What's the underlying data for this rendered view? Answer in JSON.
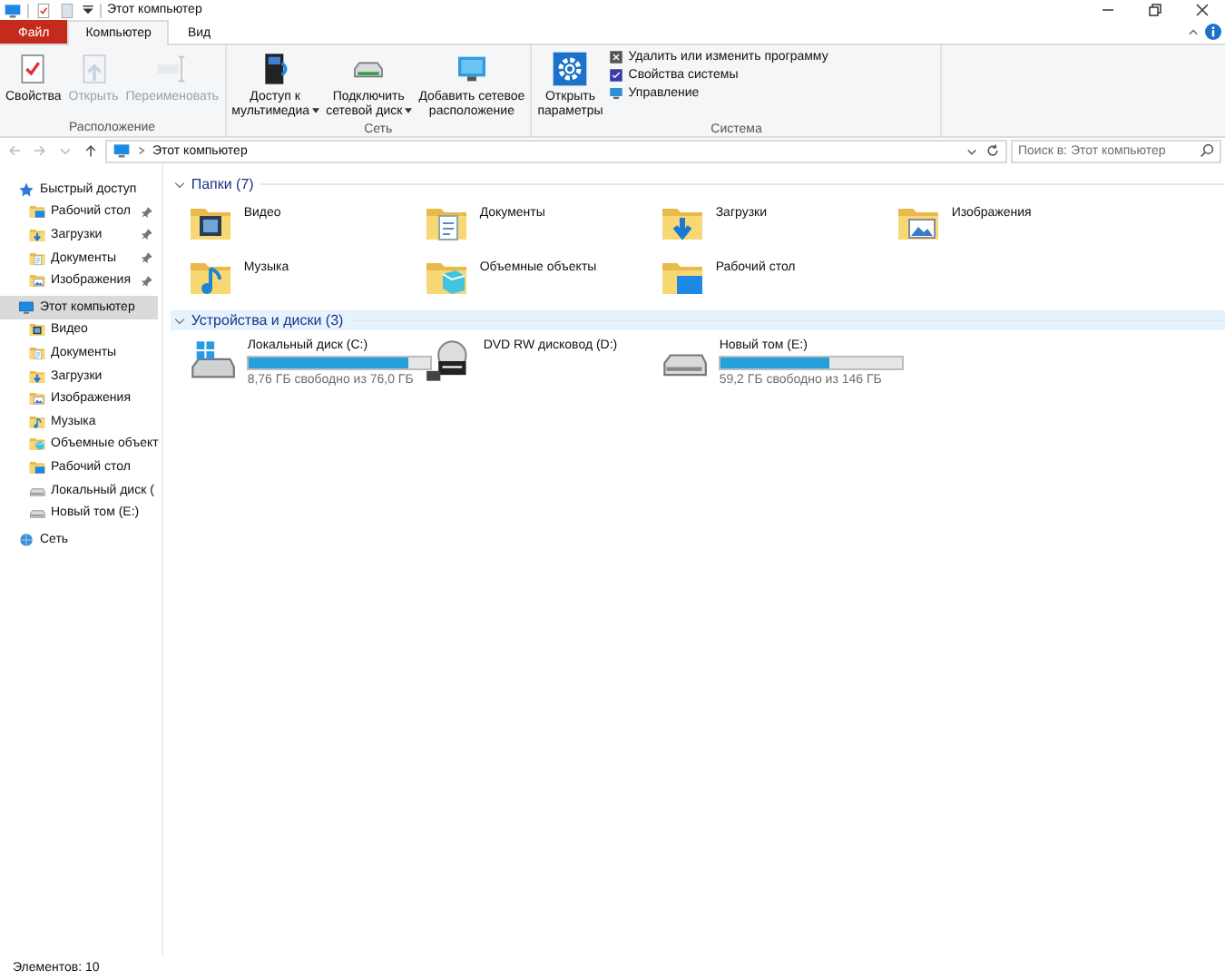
{
  "window": {
    "title": "Этот компьютер"
  },
  "ribbon": {
    "tabs": [
      {
        "label": "Файл",
        "kind": "file",
        "selected": false
      },
      {
        "label": "Компьютер",
        "kind": "tab",
        "selected": true
      },
      {
        "label": "Вид",
        "kind": "tab",
        "selected": false
      }
    ],
    "groups": [
      {
        "label": "Расположение",
        "buttons": [
          {
            "label": "Свойства",
            "disabled": false,
            "dropdown": false
          },
          {
            "label": "Открыть",
            "disabled": true,
            "dropdown": false
          },
          {
            "label": "Переименовать",
            "disabled": true,
            "dropdown": false
          }
        ]
      },
      {
        "label": "Сеть",
        "buttons": [
          {
            "label": "Доступ к\nмультимедиа",
            "disabled": false,
            "dropdown": true
          },
          {
            "label": "Подключить\nсетевой диск",
            "disabled": false,
            "dropdown": true
          },
          {
            "label": "Добавить сетевое\nрасположение",
            "disabled": false,
            "dropdown": false
          }
        ]
      },
      {
        "label": "Система",
        "buttons": [
          {
            "label": "Открыть\nпараметры",
            "disabled": false,
            "dropdown": false
          }
        ],
        "small_items": [
          {
            "label": "Удалить или изменить программу"
          },
          {
            "label": "Свойства системы"
          },
          {
            "label": "Управление"
          }
        ]
      }
    ]
  },
  "address": {
    "path": "Этот компьютер",
    "search_placeholder": "Поиск в: Этот компьютер"
  },
  "sidebar": {
    "items": [
      {
        "label": "Быстрый доступ",
        "kind": "star",
        "selected": false,
        "children": [
          {
            "label": "Рабочий стол",
            "kind": "desktop",
            "pinned": true,
            "selected": false
          },
          {
            "label": "Загрузки",
            "kind": "downloads",
            "pinned": true,
            "selected": false
          },
          {
            "label": "Документы",
            "kind": "documents",
            "pinned": true,
            "selected": false
          },
          {
            "label": "Изображения",
            "kind": "pictures",
            "pinned": true,
            "selected": false
          }
        ]
      },
      {
        "label": "Этот компьютер",
        "kind": "pc",
        "selected": true,
        "children": [
          {
            "label": "Видео",
            "kind": "video",
            "pinned": false,
            "selected": false
          },
          {
            "label": "Документы",
            "kind": "documents",
            "pinned": false,
            "selected": false
          },
          {
            "label": "Загрузки",
            "kind": "downloads",
            "pinned": false,
            "selected": false
          },
          {
            "label": "Изображения",
            "kind": "pictures",
            "pinned": false,
            "selected": false
          },
          {
            "label": "Музыка",
            "kind": "music",
            "pinned": false,
            "selected": false
          },
          {
            "label": "Объемные объект",
            "kind": "objects",
            "pinned": false,
            "selected": false
          },
          {
            "label": "Рабочий стол",
            "kind": "desktop",
            "pinned": false,
            "selected": false
          },
          {
            "label": "Локальный диск (",
            "kind": "drive",
            "pinned": false,
            "selected": false
          },
          {
            "label": "Новый том (E:)",
            "kind": "drive",
            "pinned": false,
            "selected": false
          }
        ]
      },
      {
        "label": "Сеть",
        "kind": "network",
        "selected": false
      }
    ]
  },
  "sections": [
    {
      "title": "Папки (7)",
      "expanded": true,
      "hovered": false,
      "kind": "folders",
      "items": [
        {
          "name": "Видео",
          "kind": "video"
        },
        {
          "name": "Документы",
          "kind": "documents"
        },
        {
          "name": "Загрузки",
          "kind": "downloads"
        },
        {
          "name": "Изображения",
          "kind": "pictures"
        },
        {
          "name": "Музыка",
          "kind": "music"
        },
        {
          "name": "Объемные объекты",
          "kind": "objects"
        },
        {
          "name": "Рабочий стол",
          "kind": "desktop"
        }
      ]
    },
    {
      "title": "Устройства и диски (3)",
      "expanded": true,
      "hovered": true,
      "kind": "drives",
      "items": [
        {
          "name": "Локальный диск (C:)",
          "kind": "windrive",
          "level": 0.88,
          "free": "8,76 ГБ свободно из 76,0 ГБ"
        },
        {
          "name": "DVD RW дисковод (D:)",
          "kind": "dvd"
        },
        {
          "name": "Новый том (E:)",
          "kind": "drive",
          "level": 0.6,
          "free": "59,2 ГБ свободно из 146 ГБ"
        }
      ]
    }
  ],
  "status_bar": {
    "count": "Элементов: 10"
  }
}
